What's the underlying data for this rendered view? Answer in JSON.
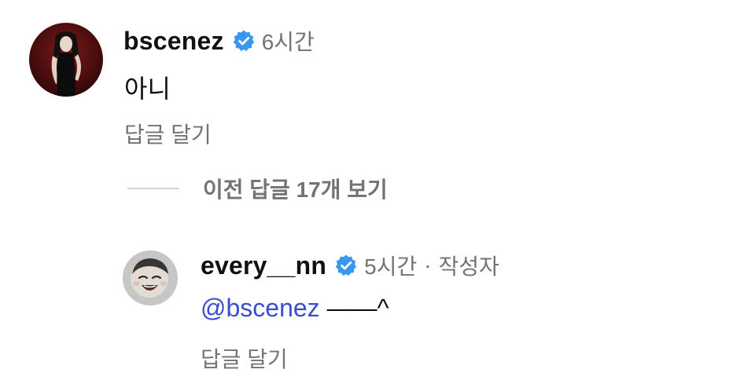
{
  "comment": {
    "username": "bscenez",
    "verified": true,
    "time": "6시간",
    "text": "아니",
    "reply_label": "답글 달기",
    "avatar_icon": "profile-photo-woman-black-dress"
  },
  "thread": {
    "view_previous_label": "이전 답글 17개 보기"
  },
  "reply": {
    "username": "every__nn",
    "verified": true,
    "time": "5시간",
    "separator": "·",
    "author_tag": "작성자",
    "mention": "@bscenez",
    "text": " ——^",
    "reply_label": "답글 달기",
    "avatar_icon": "profile-photo-laughing-baby"
  },
  "colors": {
    "verified_badge": "#3897f0",
    "mention": "#3a4dcf",
    "secondary_text": "#737373",
    "primary_text": "#111111"
  }
}
